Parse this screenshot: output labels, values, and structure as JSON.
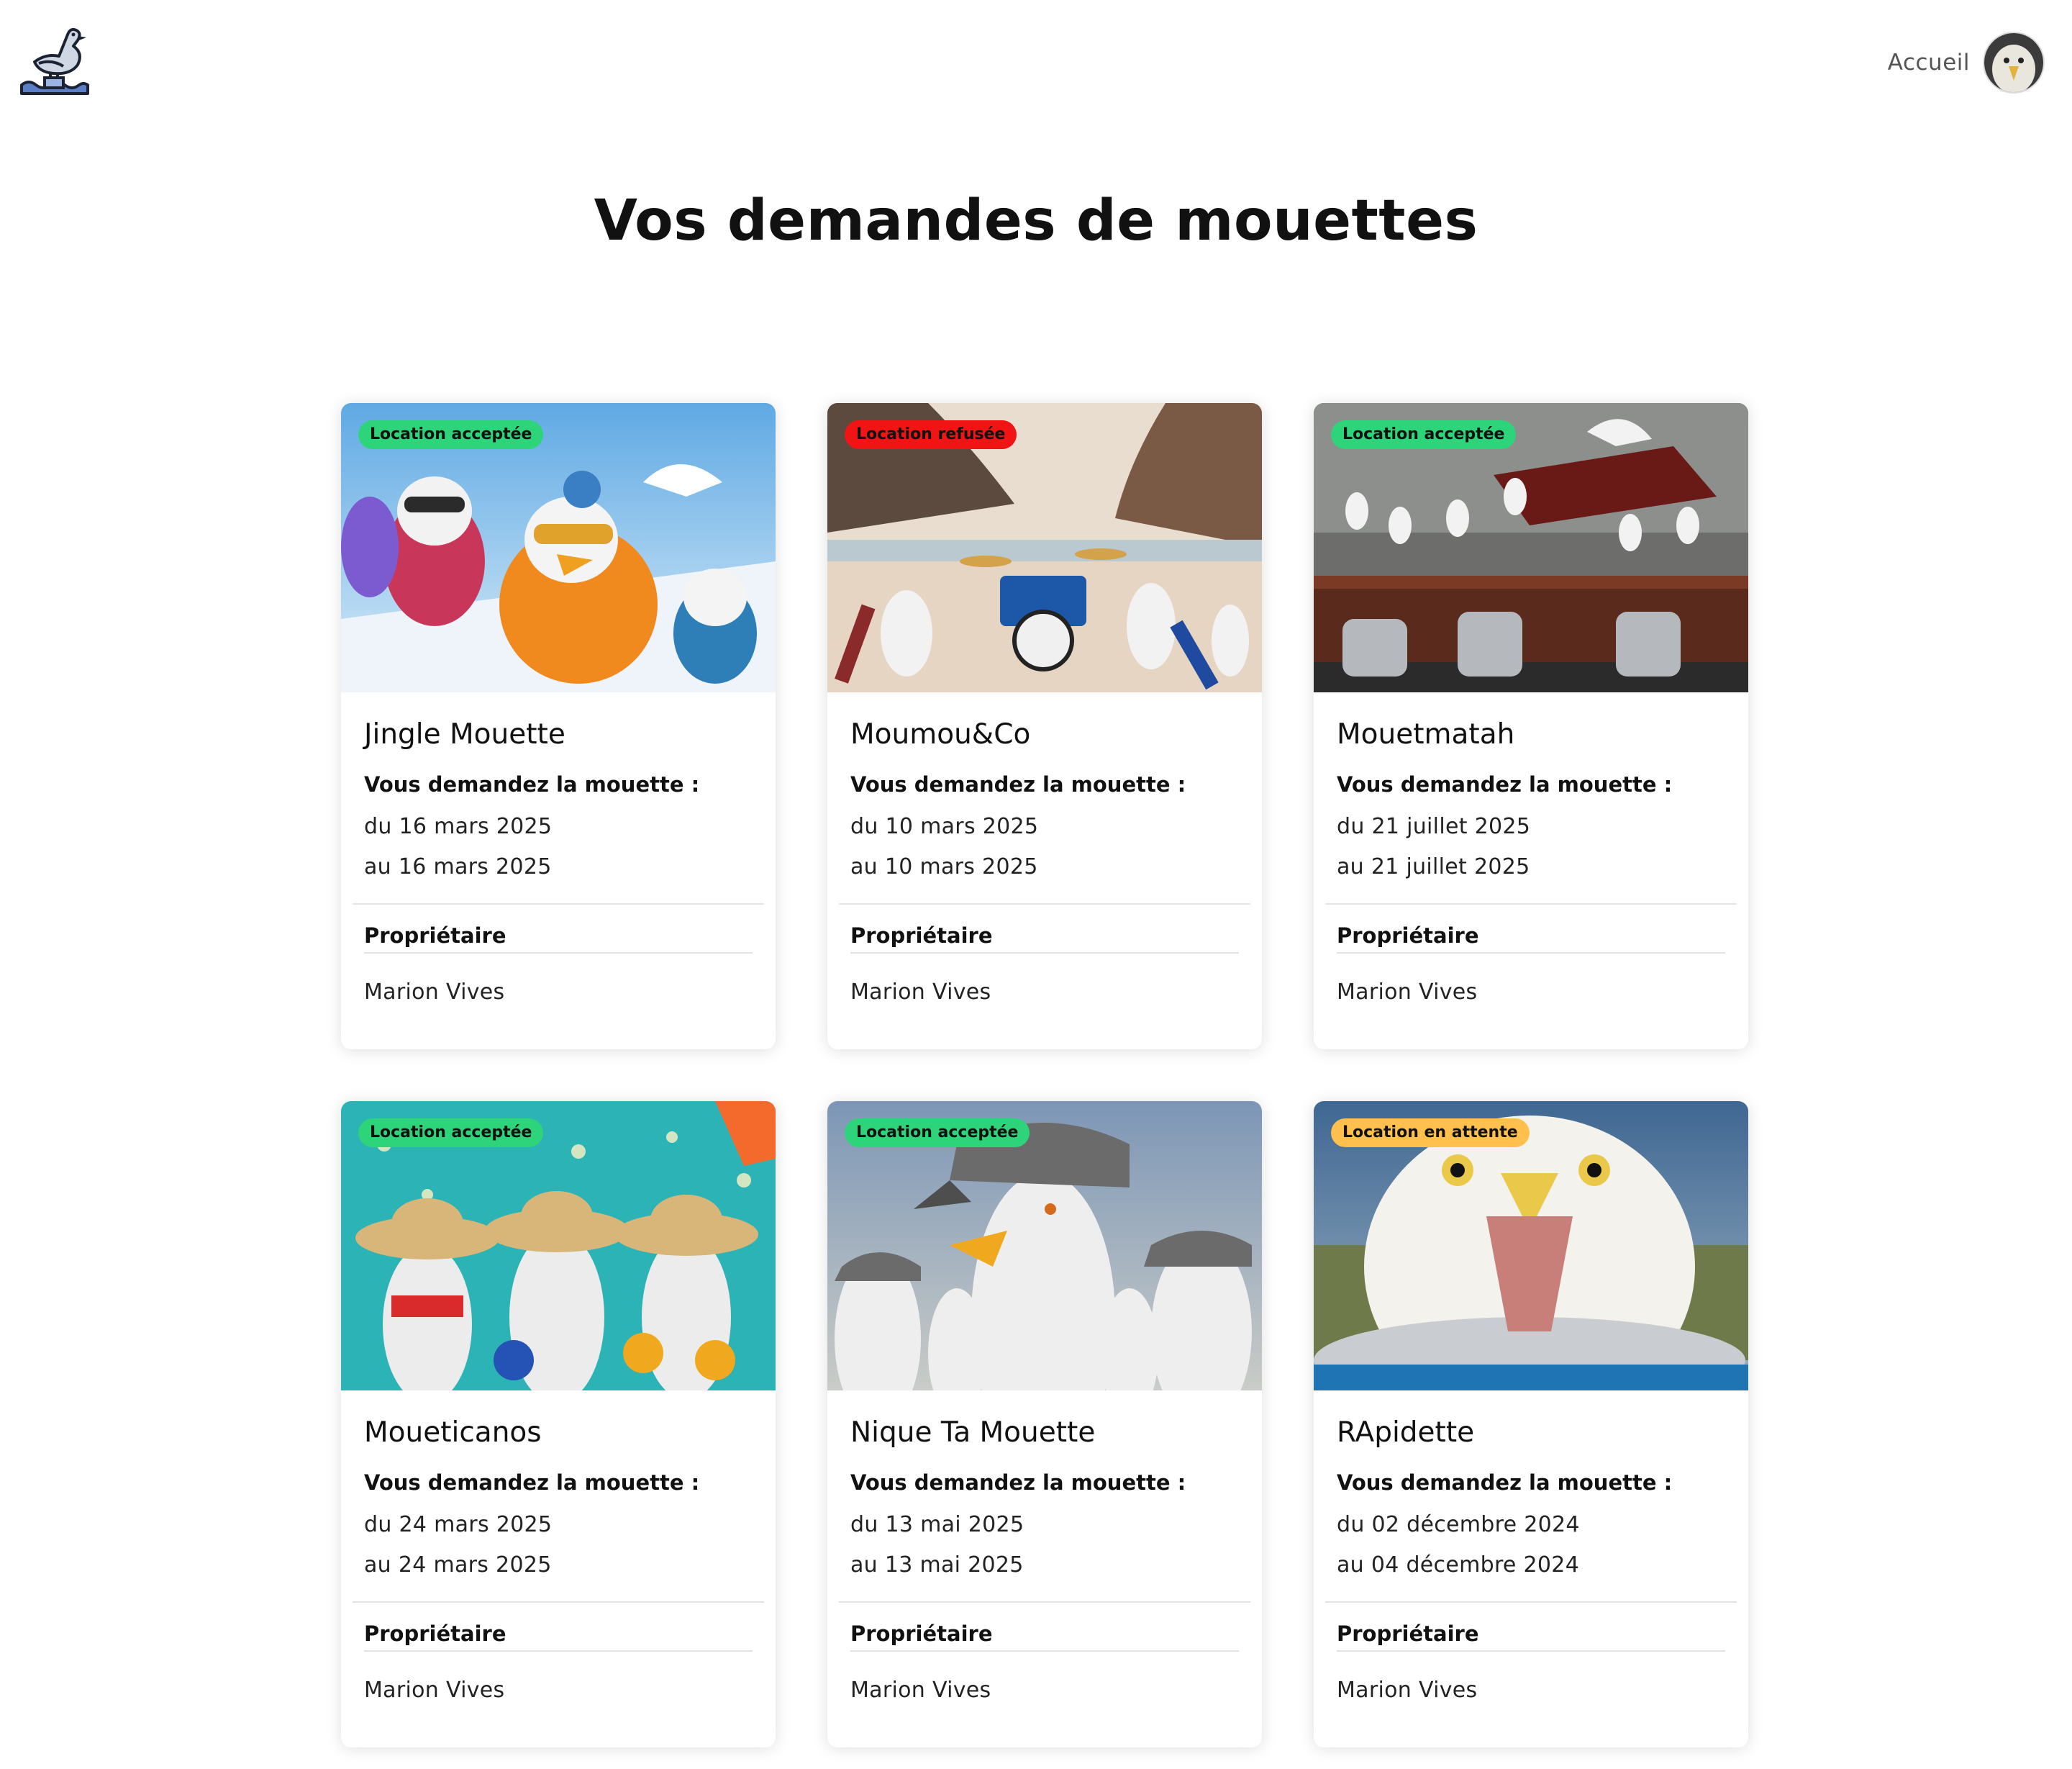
{
  "header": {
    "logo_icon": "seagull-logo-icon",
    "home_link": "Accueil",
    "avatar_icon": "seagull-avatar-icon"
  },
  "page": {
    "title": "Vos demandes de mouettes"
  },
  "status_colors": {
    "accepted": "#2ed47a",
    "refused": "#f01414",
    "pending": "#ffc04d"
  },
  "cards": [
    {
      "status": "Location acceptée",
      "status_type": "accepted",
      "title": "Jingle Mouette",
      "request_label": "Vous demandez la mouette :",
      "date_from": "du 16 mars 2025",
      "date_to": "au 16 mars 2025",
      "owner_label": "Propriétaire",
      "owner_name": "Marion Vives",
      "image": "ski-seagulls"
    },
    {
      "status": "Location refusée",
      "status_type": "refused",
      "title": "Moumou&Co",
      "request_label": "Vous demandez la mouette :",
      "date_from": "du 10 mars 2025",
      "date_to": "au 10 mars 2025",
      "owner_label": "Propriétaire",
      "owner_name": "Marion Vives",
      "image": "beach-band-seagulls"
    },
    {
      "status": "Location acceptée",
      "status_type": "accepted",
      "title": "Mouetmatah",
      "request_label": "Vous demandez la mouette :",
      "date_from": "du 21 juillet 2025",
      "date_to": "au 21 juillet 2025",
      "owner_label": "Propriétaire",
      "owner_name": "Marion Vives",
      "image": "piano-seagulls"
    },
    {
      "status": "Location acceptée",
      "status_type": "accepted",
      "title": "Moueticanos",
      "request_label": "Vous demandez la mouette :",
      "date_from": "du 24 mars 2025",
      "date_to": "au 24 mars 2025",
      "owner_label": "Propriétaire",
      "owner_name": "Marion Vives",
      "image": "mariachi-seagulls"
    },
    {
      "status": "Location acceptée",
      "status_type": "accepted",
      "title": "Nique Ta Mouette",
      "request_label": "Vous demandez la mouette :",
      "date_from": "du 13 mai 2025",
      "date_to": "au 13 mai 2025",
      "owner_label": "Propriétaire",
      "owner_name": "Marion Vives",
      "image": "cap-seagulls"
    },
    {
      "status": "Location en attente",
      "status_type": "pending",
      "title": "RApidette",
      "request_label": "Vous demandez la mouette :",
      "date_from": "du 02 décembre 2024",
      "date_to": "au 04 décembre 2024",
      "owner_label": "Propriétaire",
      "owner_name": "Marion Vives",
      "image": "screaming-seagull"
    }
  ]
}
